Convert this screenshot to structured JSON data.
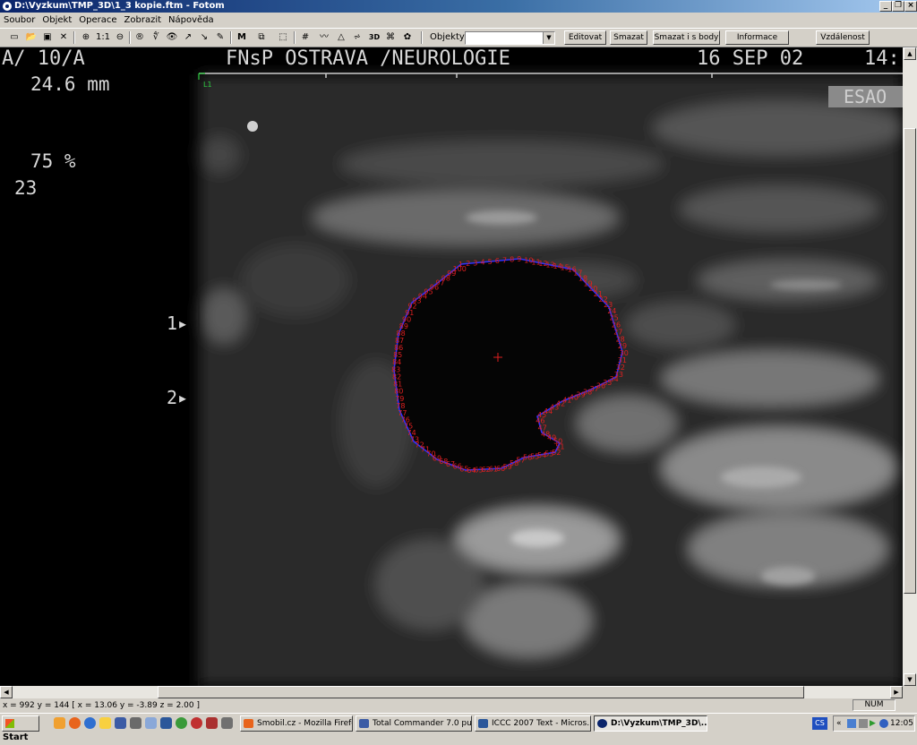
{
  "window": {
    "title": "D:\\Vyzkum\\TMP_3D\\1_3 kopie.ftm - Fotom"
  },
  "menu": [
    "Soubor",
    "Objekt",
    "Operace",
    "Zobrazit",
    "Nápověda"
  ],
  "toolbar": {
    "zoom_label": "1:1",
    "m_label": "M",
    "objects_label": "Objekty:",
    "objects_value": "",
    "buttons": [
      "Editovat",
      "Smazat",
      "Smazat i s body",
      "Informace",
      "Vzdálenost"
    ]
  },
  "image": {
    "header_left": "A/ 10/A",
    "header_center": "FNsP OSTRAVA /NEUROLOGIE",
    "header_date": "16 SEP 02",
    "header_time": "14:",
    "depth": "24.6 mm",
    "gain": "75 %",
    "frame": "23",
    "marker_1": "1▸",
    "marker_2": "2▸",
    "tag": "ESAO",
    "l1_label": "L1",
    "contour_color": "#3030ff",
    "label_color": "#e02020"
  },
  "contour_label_samples": [
    "1",
    "2",
    "3",
    "4",
    "5",
    "6",
    "7",
    "8",
    "9",
    "10",
    "11",
    "12",
    "13",
    "14",
    "15",
    "16",
    "17",
    "18",
    "19",
    "20",
    "21",
    "22",
    "23",
    "24",
    "25",
    "26",
    "27",
    "28",
    "29",
    "30",
    "31",
    "32",
    "33",
    "34",
    "35",
    "36",
    "37",
    "38",
    "39",
    "40",
    "41",
    "42",
    "43",
    "44",
    "45",
    "46",
    "47",
    "48",
    "49",
    "50",
    "51",
    "52",
    "53",
    "54",
    "55",
    "56",
    "57",
    "58",
    "59",
    "60",
    "61",
    "62",
    "63",
    "64",
    "65",
    "66",
    "67",
    "68",
    "69",
    "70",
    "71",
    "72",
    "73",
    "74",
    "75",
    "76",
    "77",
    "78",
    "79",
    "80",
    "81",
    "82",
    "83",
    "84",
    "85",
    "86",
    "87",
    "88",
    "89",
    "90",
    "91",
    "92",
    "93",
    "94",
    "95",
    "96",
    "97",
    "98",
    "99",
    "100"
  ],
  "status": {
    "coords": "x = 992   y = 144  [ x = 13.06   y = -3.89   z = 2.00  ]",
    "num": "NUM"
  },
  "taskbar": {
    "start": "Start",
    "tasks": [
      "Smobil.cz - Mozilla Firefox",
      "Total Commander 7.0 pu...",
      "ICCC 2007 Text - Micros...",
      "D:\\Vyzkum\\TMP_3D\\..."
    ],
    "lang": "CS",
    "clock": "12:05"
  }
}
